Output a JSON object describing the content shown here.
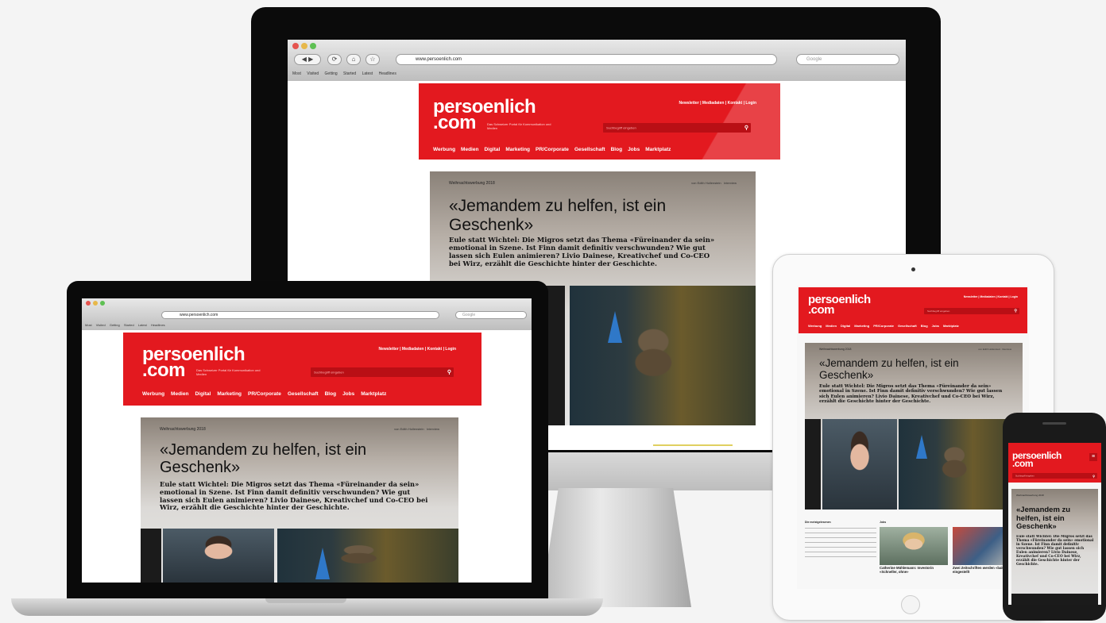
{
  "site": {
    "logo_line1": "persoenlich",
    "logo_line2": ".com",
    "tagline": "Das Schweizer Portal für Kommunikation und Medien",
    "toplinks": "Newsletter | Mediadaten | Kontakt | Login",
    "search_placeholder": "Suchbegriff eingeben",
    "nav": [
      "Werbung",
      "Medien",
      "Digital",
      "Marketing",
      "PR/Corporate",
      "Gesellschaft",
      "Blog",
      "Jobs",
      "Marktplatz"
    ],
    "kicker": "Weihnachtswerbung 2018",
    "byline": "von Edith Hollenstein",
    "byline_tag": "Interview",
    "headline": "«Jemandem zu helfen, ist ein Geschenk»",
    "lead": "Eule statt Wichtel: Die Migros setzt das Thema «Füreinander da sein» emotional in Szene. Ist Finn damit definitiv verschwunden? Wie gut lassen sich Eulen animieren? Livio Dainese, Kreativchef und Co-CEO bei Wirz, erzählt die Geschichte hinter der Geschichte."
  },
  "browser": {
    "url": "www.persoenlich.com",
    "search_placeholder": "Google",
    "bookmarks": [
      "Most Visited",
      "Getting Started",
      "Latest Headlines"
    ]
  },
  "ipad_articles": {
    "col_left_heading": "Die meistgelesenen",
    "col_mid_heading": "Jobs",
    "card1_title": "Catherine Mühlemann: Investorin «Schneller, ohne»",
    "card2_title": "Zwei Zeitschriften werden «bald» eingestellt"
  },
  "colors": {
    "brand_red": "#e3191f",
    "nav_dark_red": "#b90f15"
  }
}
